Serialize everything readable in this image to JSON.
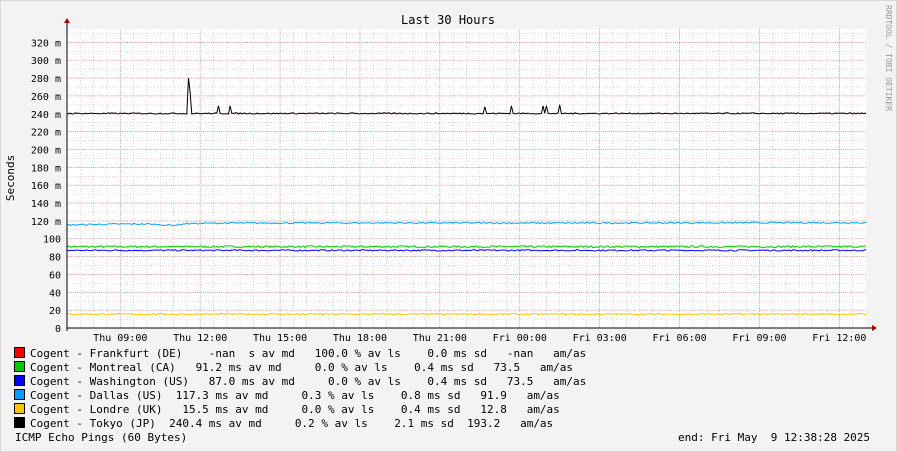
{
  "chart_data": {
    "type": "line",
    "title": "Last 30 Hours",
    "ylabel": "Seconds",
    "ylim": [
      0,
      335
    ],
    "y_ticks": [
      {
        "v": 0,
        "label": "0"
      },
      {
        "v": 20,
        "label": "20"
      },
      {
        "v": 40,
        "label": "40"
      },
      {
        "v": 60,
        "label": "60"
      },
      {
        "v": 80,
        "label": "80"
      },
      {
        "v": 100,
        "label": "100"
      },
      {
        "v": 120,
        "label": "120 m"
      },
      {
        "v": 140,
        "label": "140 m"
      },
      {
        "v": 160,
        "label": "160 m"
      },
      {
        "v": 180,
        "label": "180 m"
      },
      {
        "v": 200,
        "label": "200 m"
      },
      {
        "v": 220,
        "label": "220 m"
      },
      {
        "v": 240,
        "label": "240 m"
      },
      {
        "v": 260,
        "label": "260 m"
      },
      {
        "v": 280,
        "label": "280 m"
      },
      {
        "v": 300,
        "label": "300 m"
      },
      {
        "v": 320,
        "label": "320 m"
      }
    ],
    "xlim": [
      0,
      30
    ],
    "x_ticks": [
      {
        "v": 2.0,
        "label": "Thu 09:00"
      },
      {
        "v": 5.0,
        "label": "Thu 12:00"
      },
      {
        "v": 8.0,
        "label": "Thu 15:00"
      },
      {
        "v": 11.0,
        "label": "Thu 18:00"
      },
      {
        "v": 14.0,
        "label": "Thu 21:00"
      },
      {
        "v": 17.0,
        "label": "Fri 00:00"
      },
      {
        "v": 20.0,
        "label": "Fri 03:00"
      },
      {
        "v": 23.0,
        "label": "Fri 06:00"
      },
      {
        "v": 26.0,
        "label": "Fri 09:00"
      },
      {
        "v": 29.0,
        "label": "Fri 12:00"
      }
    ],
    "grid": true,
    "series": [
      {
        "name": "Cogent - Frankfurt (DE)",
        "color": "#ff0000",
        "baseline": null,
        "noise": 0,
        "x": [],
        "y": []
      },
      {
        "name": "Cogent - Montreal (CA)",
        "color": "#00cc00",
        "baseline": 91.2,
        "noise": 1.0,
        "x": [
          0,
          30
        ],
        "y": [
          91.2,
          91.2
        ]
      },
      {
        "name": "Cogent - Washington (US)",
        "color": "#0000ff",
        "baseline": 87.0,
        "noise": 0.8,
        "x": [
          0,
          30
        ],
        "y": [
          87.0,
          87.0
        ]
      },
      {
        "name": "Cogent - Dallas (US)",
        "color": "#00a0ff",
        "baseline": 117.3,
        "noise": 0.8,
        "x": [
          0,
          1.0,
          2.0,
          3.0,
          4.0,
          4.5,
          6.0,
          12.0,
          18.0,
          24.0,
          30.0
        ],
        "y": [
          115.5,
          116.0,
          116.5,
          116.5,
          115.0,
          117.0,
          117.6,
          117.8,
          117.6,
          117.9,
          118.0
        ]
      },
      {
        "name": "Cogent - Londre (UK)",
        "color": "#f0c800",
        "baseline": 15.5,
        "noise": 0.8,
        "x": [
          0,
          30
        ],
        "y": [
          15.5,
          15.5
        ]
      },
      {
        "name": "Cogent - Tokyo (JP)",
        "color": "#000000",
        "baseline": 240.4,
        "noise": 0.7,
        "x": [
          0,
          30
        ],
        "y": [
          240.4,
          240.4
        ],
        "spikes": [
          {
            "x": 4.55,
            "y": 280
          },
          {
            "x": 4.62,
            "y": 263
          },
          {
            "x": 5.7,
            "y": 249
          },
          {
            "x": 6.1,
            "y": 249
          },
          {
            "x": 15.7,
            "y": 248
          },
          {
            "x": 16.7,
            "y": 249
          },
          {
            "x": 17.9,
            "y": 249
          },
          {
            "x": 18.0,
            "y": 249
          },
          {
            "x": 18.5,
            "y": 250
          }
        ]
      }
    ]
  },
  "legend": [
    {
      "color": "#ff0000",
      "text": "Cogent - Frankfurt (DE)    -nan  s av md   100.0 % av ls    0.0 ms sd   -nan   am/as"
    },
    {
      "color": "#00cc00",
      "text": "Cogent - Montreal (CA)   91.2 ms av md     0.0 % av ls    0.4 ms sd   73.5   am/as"
    },
    {
      "color": "#0000ff",
      "text": "Cogent - Washington (US)   87.0 ms av md     0.0 % av ls    0.4 ms sd   73.5   am/as"
    },
    {
      "color": "#00a0ff",
      "text": "Cogent - Dallas (US)  117.3 ms av md     0.3 % av ls    0.8 ms sd   91.9   am/as"
    },
    {
      "color": "#f0c800",
      "text": "Cogent - Londre (UK)   15.5 ms av md     0.0 % av ls    0.4 ms sd   12.8   am/as"
    },
    {
      "color": "#000000",
      "text": "Cogent - Tokyo (JP)  240.4 ms av md     0.2 % av ls    2.1 ms sd  193.2   am/as"
    }
  ],
  "footer": {
    "left": "ICMP Echo Pings (60 Bytes)",
    "right": "end: Fri May  9 12:38:28 2025"
  },
  "watermark": "RRDTOOL / TOBI OETIKER"
}
